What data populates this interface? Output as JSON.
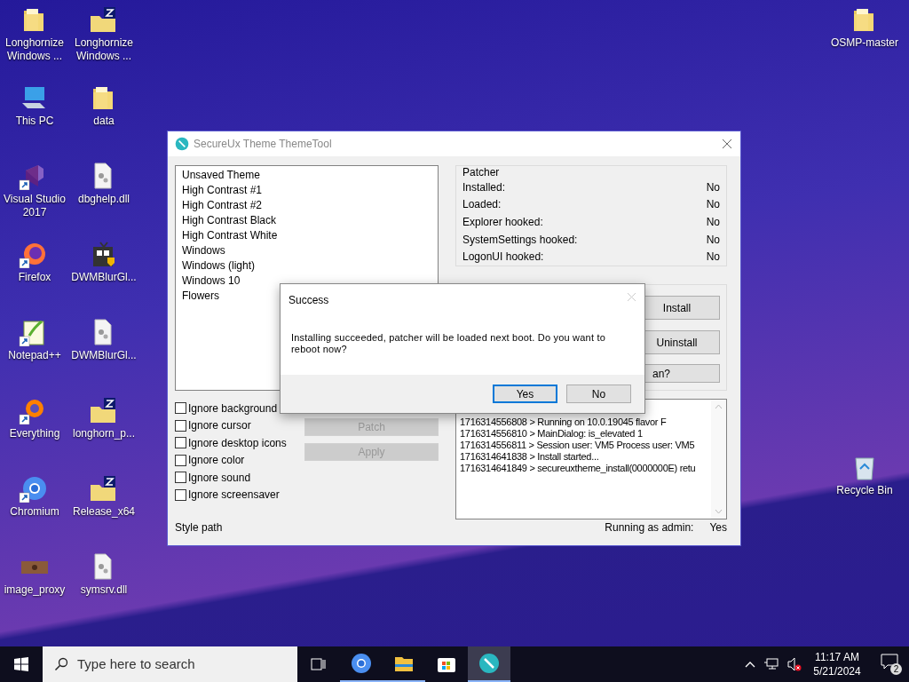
{
  "desktop": {
    "left_icons": [
      {
        "label": "Longhornize Windows ...",
        "kind": "folder"
      },
      {
        "label": "Longhornize Windows ...",
        "kind": "archive"
      },
      {
        "label": "This PC",
        "kind": "computer"
      },
      {
        "label": "data",
        "kind": "folder"
      },
      {
        "label": "Visual Studio 2017",
        "kind": "studio",
        "shortcut": true
      },
      {
        "label": "dbghelp.dll",
        "kind": "file"
      },
      {
        "label": "Firefox",
        "kind": "firefox",
        "shortcut": true
      },
      {
        "label": "DWMBlurGl...",
        "kind": "installer"
      },
      {
        "label": "Notepad++",
        "kind": "notepad",
        "shortcut": true
      },
      {
        "label": "DWMBlurGl...",
        "kind": "file"
      },
      {
        "label": "Everything",
        "kind": "everything",
        "shortcut": true
      },
      {
        "label": "longhorn_p...",
        "kind": "archive"
      },
      {
        "label": "Chromium",
        "kind": "chromium",
        "shortcut": true
      },
      {
        "label": "Release_x64",
        "kind": "archive"
      },
      {
        "label": "image_proxy",
        "kind": "image"
      },
      {
        "label": "symsrv.dll",
        "kind": "file"
      }
    ],
    "right_icons": [
      {
        "label": "OSMP-master",
        "kind": "folder"
      },
      {
        "label": "Recycle Bin",
        "kind": "recycle"
      }
    ]
  },
  "window": {
    "title": "SecureUx Theme ThemeTool",
    "themes": [
      "Unsaved Theme",
      "High Contrast #1",
      "High Contrast #2",
      "High Contrast Black",
      "High Contrast White",
      "Windows",
      "Windows (light)",
      "Windows 10",
      "Flowers"
    ],
    "options": [
      {
        "label": "Ignore background",
        "checked": false
      },
      {
        "label": "Ignore cursor",
        "checked": false
      },
      {
        "label": "Ignore desktop icons",
        "checked": false
      },
      {
        "label": "Ignore color",
        "checked": false
      },
      {
        "label": "Ignore sound",
        "checked": false
      },
      {
        "label": "Ignore screensaver",
        "checked": false
      }
    ],
    "actions": [
      {
        "label": "Patch",
        "disabled": true
      },
      {
        "label": "Apply",
        "disabled": true
      }
    ],
    "style_path_label": "Style path",
    "patcher": {
      "title": "Patcher",
      "rows": [
        {
          "label": "Installed:",
          "value": "No"
        },
        {
          "label": "Loaded:",
          "value": "No"
        },
        {
          "label": "Explorer hooked:",
          "value": "No"
        },
        {
          "label": "SystemSettings hooked:",
          "value": "No"
        },
        {
          "label": "LogonUI hooked:",
          "value": "No"
        }
      ]
    },
    "installation": {
      "buttons": [
        {
          "label": "Install",
          "disabled": false
        },
        {
          "label": "Uninstall",
          "disabled": false
        },
        {
          "label": "an?",
          "disabled": false
        }
      ]
    },
    "log": [
      "1716314556808 > Running on 10.0.19045 flavor F",
      "1716314556810 > MainDialog: is_elevated 1",
      "1716314556811 > Session user: VM5 Process user: VM5",
      "1716314641838 > Install started...",
      "1716314641849 > secureuxtheme_install(0000000E) retu"
    ],
    "admin_label": "Running as admin:",
    "admin_value": "Yes"
  },
  "dialog": {
    "title": "Success",
    "message": "Installing succeeded, patcher will be loaded next boot. Do you want to reboot now?",
    "buttons": [
      {
        "label": "Yes",
        "selected": true
      },
      {
        "label": "No",
        "selected": false
      }
    ]
  },
  "taskbar": {
    "search_placeholder": "Type here to search",
    "apps": [
      {
        "kind": "chromium",
        "running": true,
        "active": false
      },
      {
        "kind": "explorer",
        "running": true,
        "active": false
      },
      {
        "kind": "store",
        "running": false,
        "active": false
      },
      {
        "kind": "themetool",
        "running": true,
        "active": true
      }
    ],
    "time": "11:17 AM",
    "date": "5/21/2024",
    "notifications": "2"
  }
}
